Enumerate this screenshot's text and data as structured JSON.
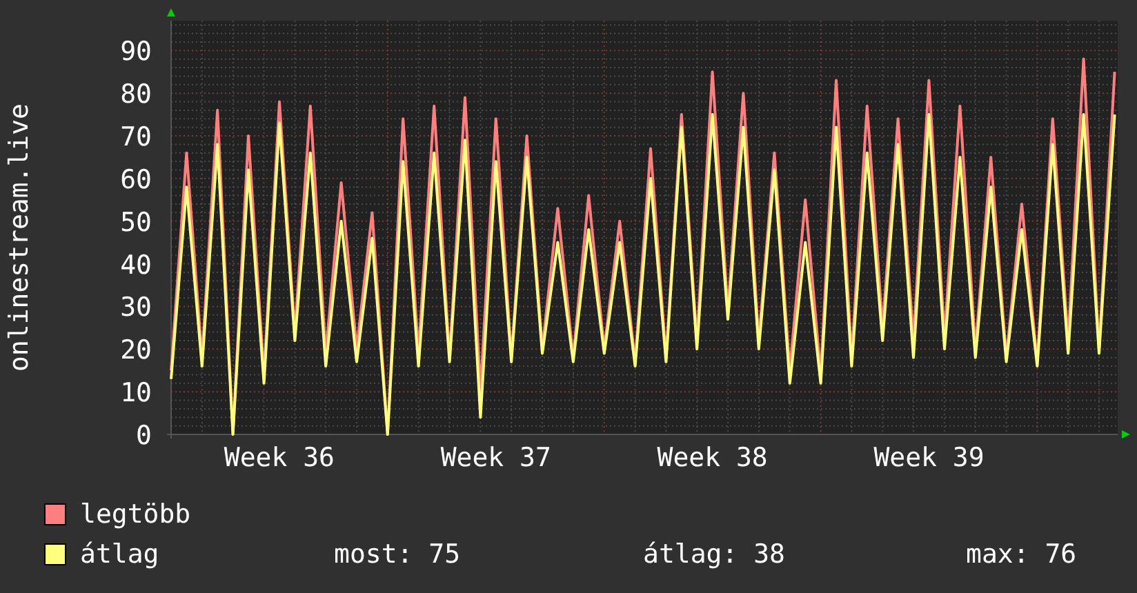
{
  "chart_data": {
    "type": "line",
    "ylabel": "onlinestream.live",
    "grid": true,
    "ylim": [
      0,
      97
    ],
    "yticks": [
      0,
      10,
      20,
      30,
      40,
      50,
      60,
      70,
      80,
      90
    ],
    "categories": [
      null,
      null,
      null,
      null,
      null,
      null,
      null,
      "Week 36",
      null,
      null,
      null,
      null,
      null,
      null,
      null,
      null,
      null,
      null,
      null,
      null,
      null,
      "Week 37",
      null,
      null,
      null,
      null,
      null,
      null,
      null,
      null,
      null,
      null,
      null,
      null,
      null,
      "Week 38",
      null,
      null,
      null,
      null,
      null,
      null,
      null,
      null,
      null,
      null,
      null,
      null,
      null,
      "Week 39",
      null,
      null,
      null,
      null,
      null,
      null,
      null,
      null,
      null,
      null,
      null,
      null
    ],
    "series": [
      {
        "name": "legtöbb",
        "color": "#ff7f7f",
        "values": [
          15,
          66,
          18,
          76,
          0,
          70,
          14,
          78,
          24,
          77,
          19,
          59,
          20,
          52,
          0,
          74,
          19,
          77,
          18,
          79,
          10,
          74,
          18,
          70,
          20,
          53,
          18,
          56,
          20,
          50,
          17,
          67,
          18,
          75,
          22,
          85,
          29,
          80,
          22,
          66,
          15,
          55,
          14,
          83,
          18,
          77,
          25,
          74,
          22,
          83,
          23,
          77,
          20,
          65,
          18,
          54,
          17,
          74,
          22,
          88,
          20,
          85
        ]
      },
      {
        "name": "átlag",
        "color": "#ffff7f",
        "values": [
          13,
          58,
          16,
          68,
          0,
          62,
          12,
          73,
          22,
          66,
          16,
          50,
          17,
          46,
          0,
          64,
          16,
          66,
          17,
          69,
          4,
          64,
          17,
          65,
          19,
          45,
          17,
          48,
          19,
          45,
          16,
          60,
          17,
          72,
          20,
          75,
          27,
          72,
          20,
          62,
          12,
          45,
          12,
          72,
          16,
          66,
          22,
          68,
          18,
          75,
          20,
          65,
          18,
          58,
          17,
          48,
          16,
          68,
          19,
          75,
          19,
          75
        ]
      }
    ]
  },
  "legend_stats": [
    "most: 75",
    "átlag: 38",
    "max: 76"
  ]
}
